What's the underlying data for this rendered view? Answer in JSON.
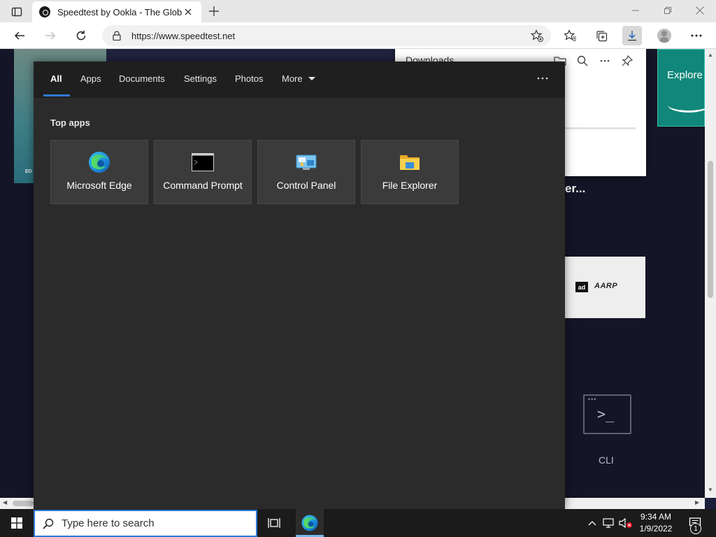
{
  "browser": {
    "tab_title": "Speedtest by Ookla - The Globa",
    "url": "https://www.speedtest.net"
  },
  "webpage": {
    "left_image_label": "ED",
    "downloads_title": "Downloads",
    "explore_text": "Explore",
    "heading_fragment": "er...",
    "ad_badge": "ad",
    "ad_brand": "AARP",
    "cli_label": "CLI"
  },
  "search_panel": {
    "tabs": [
      {
        "label": "All"
      },
      {
        "label": "Apps"
      },
      {
        "label": "Documents"
      },
      {
        "label": "Settings"
      },
      {
        "label": "Photos"
      },
      {
        "label": "More"
      }
    ],
    "section_title": "Top apps",
    "top_apps": [
      {
        "label": "Microsoft Edge",
        "icon": "edge-icon"
      },
      {
        "label": "Command Prompt",
        "icon": "command-prompt-icon"
      },
      {
        "label": "Control Panel",
        "icon": "control-panel-icon"
      },
      {
        "label": "File Explorer",
        "icon": "file-explorer-icon"
      }
    ]
  },
  "taskbar": {
    "search_placeholder": "Type here to search",
    "time": "9:34 AM",
    "date": "1/9/2022",
    "notification_count": "1"
  },
  "colors": {
    "accent": "#2f7ad6",
    "panel_bg": "#2b2b2b",
    "taskbar_bg": "#1b1b1b"
  }
}
